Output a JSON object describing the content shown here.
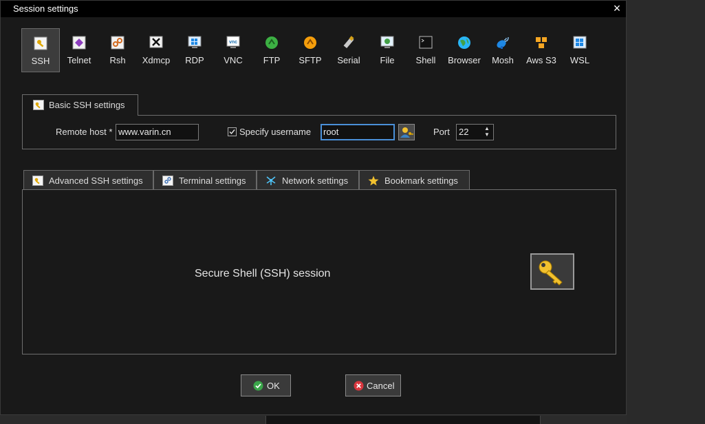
{
  "window": {
    "title": "Session settings",
    "close_glyph": "×"
  },
  "protocols": [
    {
      "label": "SSH",
      "icon": "ssh-key-icon",
      "selected": true
    },
    {
      "label": "Telnet",
      "icon": "telnet-icon"
    },
    {
      "label": "Rsh",
      "icon": "rsh-icon"
    },
    {
      "label": "Xdmcp",
      "icon": "xdmcp-icon"
    },
    {
      "label": "RDP",
      "icon": "rdp-icon"
    },
    {
      "label": "VNC",
      "icon": "vnc-icon"
    },
    {
      "label": "FTP",
      "icon": "ftp-icon"
    },
    {
      "label": "SFTP",
      "icon": "sftp-icon"
    },
    {
      "label": "Serial",
      "icon": "serial-icon"
    },
    {
      "label": "File",
      "icon": "file-icon"
    },
    {
      "label": "Shell",
      "icon": "shell-icon"
    },
    {
      "label": "Browser",
      "icon": "browser-icon"
    },
    {
      "label": "Mosh",
      "icon": "mosh-icon"
    },
    {
      "label": "Aws S3",
      "icon": "aws-s3-icon"
    },
    {
      "label": "WSL",
      "icon": "wsl-icon"
    }
  ],
  "basic": {
    "tab_label": "Basic SSH settings",
    "remote_host_label": "Remote host *",
    "remote_host_value": "www.varin.cn",
    "specify_username_label": "Specify username",
    "specify_username_checked": true,
    "username_value": "root",
    "port_label": "Port",
    "port_value": "22"
  },
  "tabs": [
    {
      "label": "Advanced SSH settings",
      "icon": "key-icon"
    },
    {
      "label": "Terminal settings",
      "icon": "terminal-icon"
    },
    {
      "label": "Network settings",
      "icon": "network-icon"
    },
    {
      "label": "Bookmark settings",
      "icon": "star-icon"
    }
  ],
  "panel": {
    "description": "Secure Shell (SSH) session"
  },
  "buttons": {
    "ok_label": "OK",
    "cancel_label": "Cancel"
  },
  "colors": {
    "accent_focus": "#4a90d9",
    "ok_green": "#3aa64a",
    "cancel_red": "#d9363e",
    "key_yellow": "#f2c12e"
  }
}
